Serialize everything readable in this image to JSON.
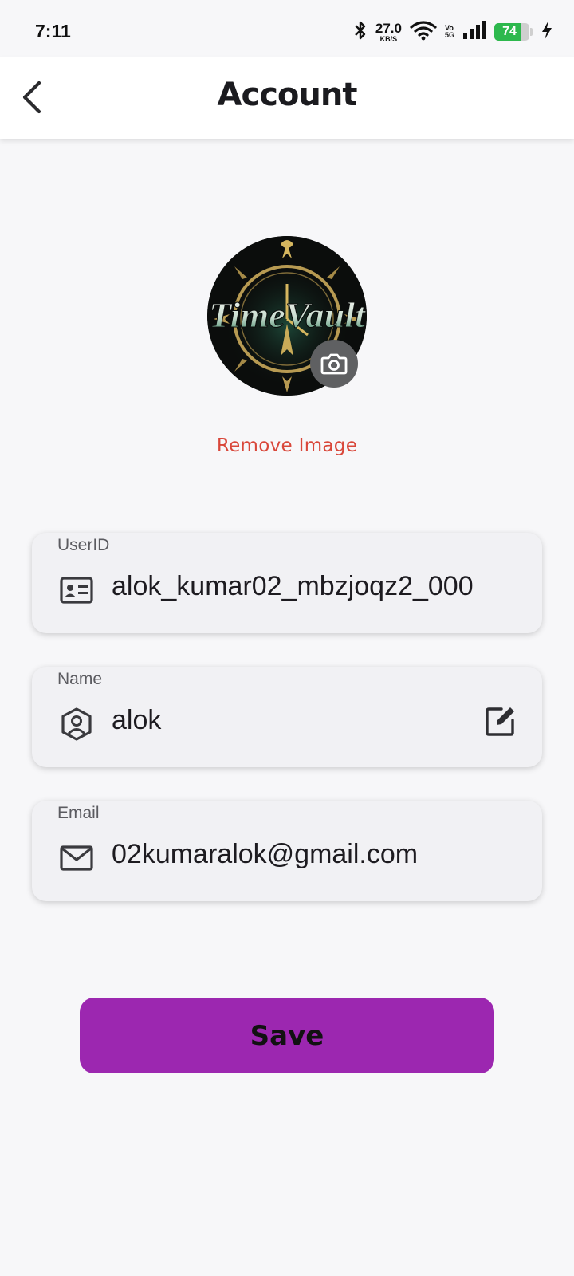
{
  "status_bar": {
    "time": "7:11",
    "network_speed_value": "27.0",
    "network_speed_unit": "KB/S",
    "volte_top": "Vo",
    "volte_bottom": "5G",
    "battery_level": "74",
    "battery_fraction": 0.74,
    "icons": [
      "bluetooth-icon",
      "wifi-icon",
      "signal-icon",
      "battery-icon",
      "charging-icon"
    ]
  },
  "app_bar": {
    "title": "Account",
    "back_icon": "chevron-left-icon"
  },
  "profile": {
    "avatar_logo_text": "TimeVault",
    "remove_image_label": "Remove Image",
    "camera_icon": "camera-icon"
  },
  "fields": {
    "user_id": {
      "label": "UserID",
      "value": "alok_kumar02_mbzjoqz2_000",
      "icon": "id-card-icon"
    },
    "name": {
      "label": "Name",
      "value": "alok",
      "icon": "user-badge-icon",
      "action_icon": "edit-icon"
    },
    "email": {
      "label": "Email",
      "value": "02kumaralok@gmail.com",
      "icon": "mail-icon"
    }
  },
  "actions": {
    "save_label": "Save"
  },
  "colors": {
    "background": "#f7f7f9",
    "field_background": "#f1f1f4",
    "save_button": "#9c27b0",
    "remove_image_text": "#d9473a",
    "battery_fill": "#2db84d",
    "camera_button": "#5f6062"
  }
}
